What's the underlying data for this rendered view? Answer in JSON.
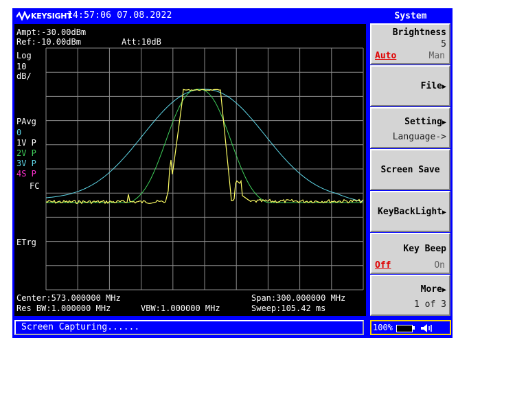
{
  "header": {
    "brand": "KEYSIGHT",
    "datetime": "14:57:06  07.08.2022"
  },
  "readout": {
    "ampt": "Ampt:-30.00dBm",
    "ref": "Ref:-10.00dBm",
    "att": "Att:10dB",
    "scale_type": "Log",
    "scale_value": "10",
    "scale_unit": "dB/",
    "detector": "PAvg",
    "trace0": "0",
    "trace1": "1V P",
    "trace2": "2V P",
    "trace3": "3V P",
    "trace4": "4S P",
    "fc": "FC",
    "etrg": "ETrg",
    "center": "Center:573.000000 MHz",
    "span": "Span:300.000000 MHz",
    "rbw": "Res BW:1.000000 MHz",
    "vbw": "VBW:1.000000 MHz",
    "sweep": "Sweep:105.42 ms"
  },
  "colors": {
    "trace_cyan": "#5fd7e8",
    "trace_green": "#3fcf5a",
    "trace_yellow": "#ffff66",
    "trace4_magenta": "#ff2fd0",
    "grid": "#8c8c8c",
    "frame_blue": "#0000ff"
  },
  "menu": {
    "title": "System",
    "brightness": {
      "label": "Brightness",
      "value": "5",
      "opt_on": "Auto",
      "opt_off": "Man"
    },
    "file": "File",
    "setting": {
      "label": "Setting",
      "sub": "Language->"
    },
    "screen_save": "Screen Save",
    "keybacklight": "KeyBackLight",
    "keybeep": {
      "label": "Key Beep",
      "opt_on": "Off",
      "opt_off": "On"
    },
    "more": {
      "label": "More",
      "page": "1 of 3"
    }
  },
  "status": {
    "message": "Screen Capturing......",
    "battery": "100%"
  }
}
